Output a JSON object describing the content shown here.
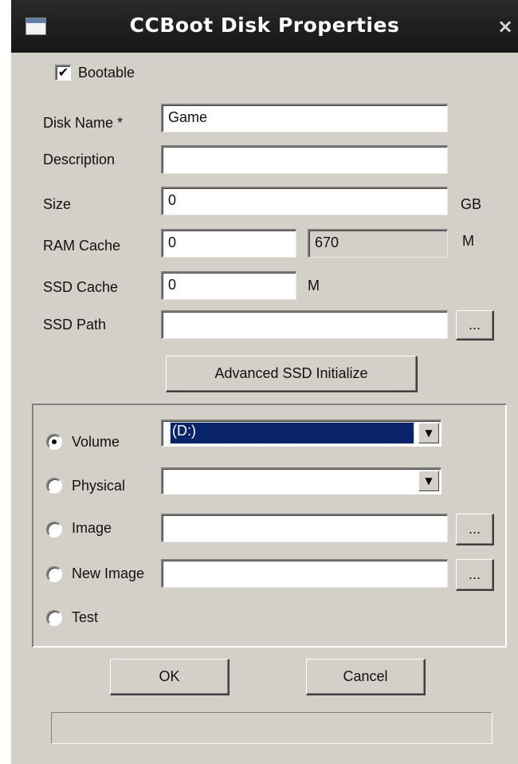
{
  "window": {
    "title": "CCBoot Disk Properties",
    "close_glyph": "×",
    "icon": "window-icon"
  },
  "bootable": {
    "label": "Bootable",
    "checked": true,
    "check_glyph": "✔"
  },
  "fields": {
    "disk_name": {
      "label": "Disk Name *",
      "value": "Game"
    },
    "description": {
      "label": "Description",
      "value": ""
    },
    "size": {
      "label": "Size",
      "value": "0",
      "unit": "GB"
    },
    "ram_cache": {
      "label": "RAM Cache",
      "value": "0",
      "available": "670",
      "unit": "M"
    },
    "ssd_cache": {
      "label": "SSD Cache",
      "value": "0",
      "unit": "M"
    },
    "ssd_path": {
      "label": "SSD Path",
      "value": "",
      "browse_label": "..."
    }
  },
  "advanced_button": "Advanced SSD Initialize",
  "source": {
    "selected": "volume",
    "volume": {
      "label": "Volume",
      "value": "(D:)"
    },
    "physical": {
      "label": "Physical",
      "value": ""
    },
    "image": {
      "label": "Image",
      "value": "",
      "browse_label": "..."
    },
    "new_image": {
      "label": "New Image",
      "value": "",
      "browse_label": "..."
    },
    "test": {
      "label": "Test"
    },
    "dropdown_glyph": "▼"
  },
  "buttons": {
    "ok": "OK",
    "cancel": "Cancel"
  },
  "progress": {
    "value": 0
  },
  "colors": {
    "face": "#d4d0c8",
    "selection": "#0a246a",
    "titlebar": "#1e1e1e"
  }
}
